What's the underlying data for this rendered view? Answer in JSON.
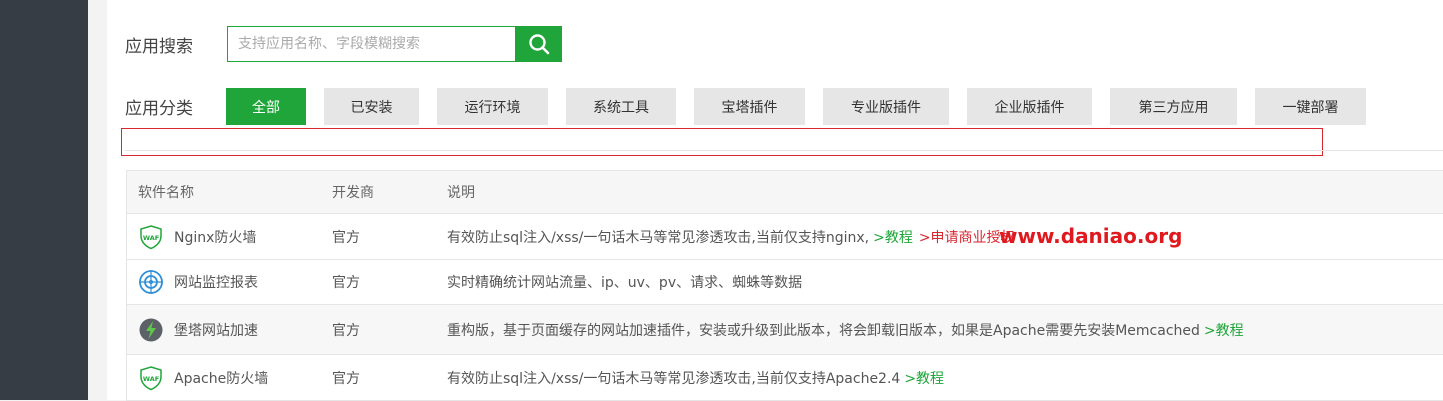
{
  "search": {
    "label": "应用搜索",
    "placeholder": "支持应用名称、字段模糊搜索",
    "value": ""
  },
  "categories": {
    "label": "应用分类",
    "items": [
      {
        "label": "全部",
        "active": true
      },
      {
        "label": "已安装",
        "active": false
      },
      {
        "label": "运行环境",
        "active": false
      },
      {
        "label": "系统工具",
        "active": false
      },
      {
        "label": "宝塔插件",
        "active": false
      },
      {
        "label": "专业版插件",
        "active": false
      },
      {
        "label": "企业版插件",
        "active": false
      },
      {
        "label": "第三方应用",
        "active": false
      },
      {
        "label": "一键部署",
        "active": false
      }
    ]
  },
  "table": {
    "columns": [
      "软件名称",
      "开发商",
      "说明"
    ],
    "rows": [
      {
        "icon": "waf-shield-icon",
        "name": "Nginx防火墙",
        "developer": "官方",
        "description": "有效防止sql注入/xss/一句话木马等常见渗透攻击,当前仅支持nginx,",
        "link1": ">教程",
        "link2": ">申请商业授权"
      },
      {
        "icon": "monitor-target-icon",
        "name": "网站监控报表",
        "developer": "官方",
        "description": "实时精确统计网站流量、ip、uv、pv、请求、蜘蛛等数据"
      },
      {
        "icon": "lightning-icon",
        "name": "堡塔网站加速",
        "developer": "官方",
        "description": "重构版，基于页面缓存的网站加速插件，安装或升级到此版本，将会卸载旧版本，如果是Apache需要先安装Memcached",
        "link1": ">教程"
      },
      {
        "icon": "waf-shield-icon",
        "name": "Apache防火墙",
        "developer": "官方",
        "description": "有效防止sql注入/xss/一句话木马等常见渗透攻击,当前仅支持Apache2.4",
        "link1": ">教程"
      }
    ]
  },
  "watermark": "www.daniao.org",
  "colors": {
    "accent": "#20a53a",
    "sidebar": "#363d45",
    "highlight": "#d9262f"
  }
}
